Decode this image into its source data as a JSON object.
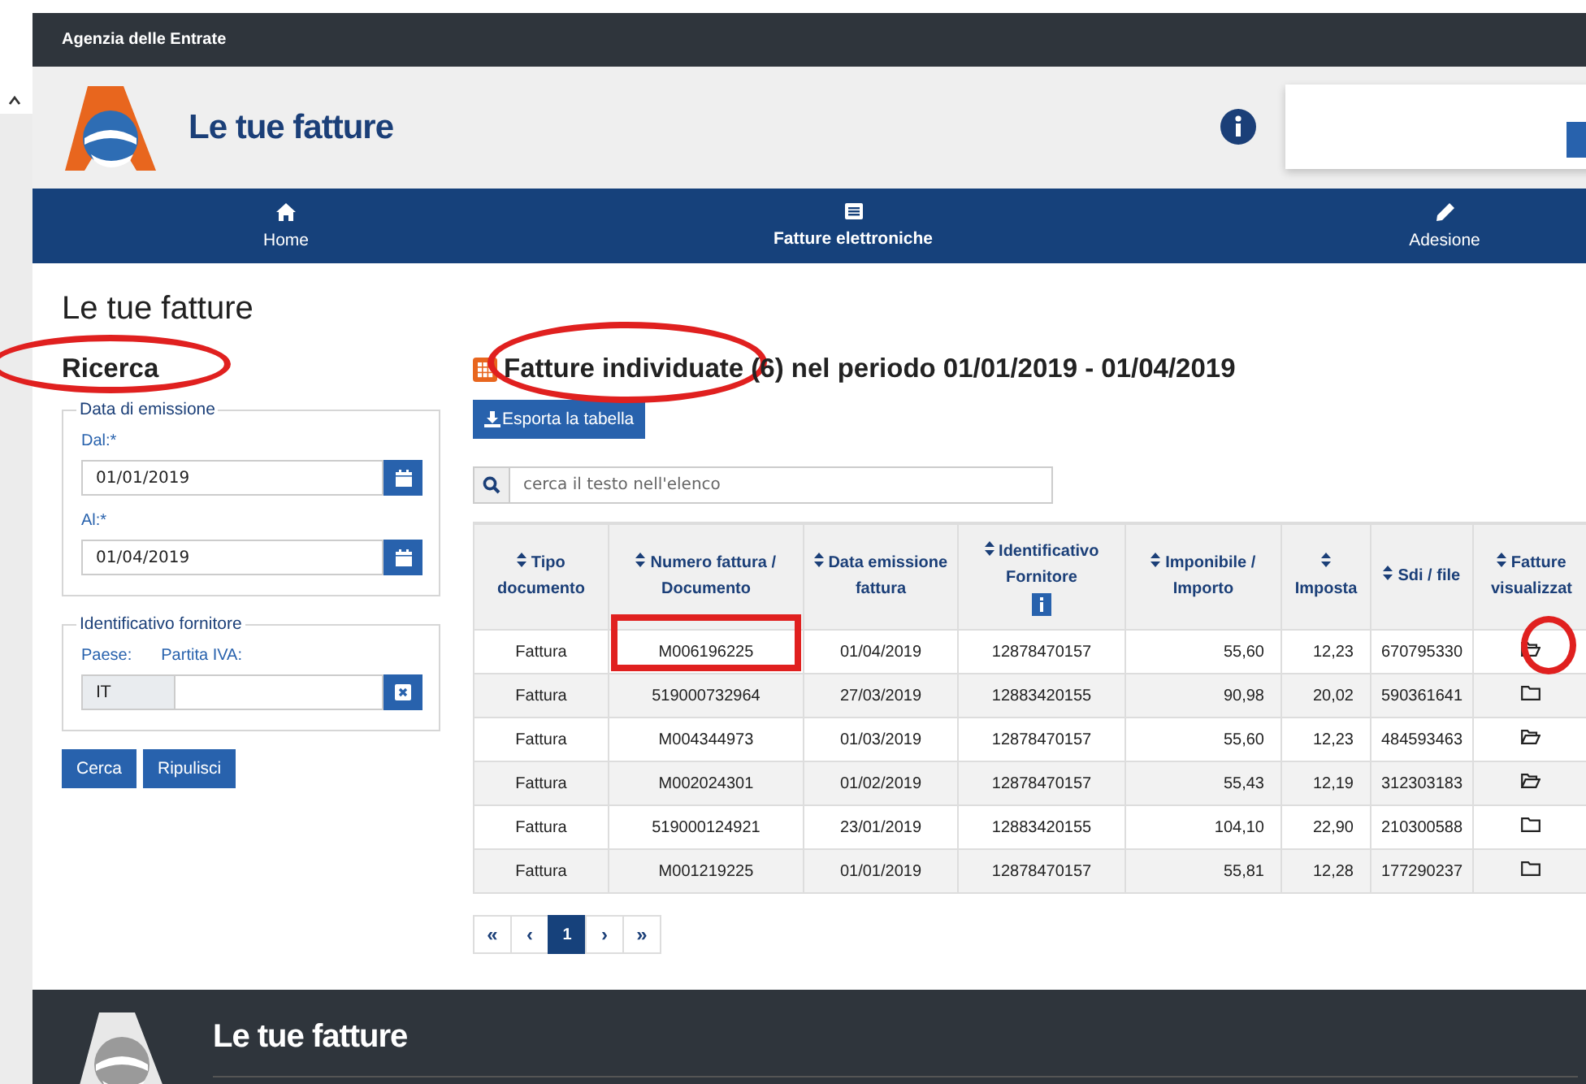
{
  "agency": "Agenzia delle Entrate",
  "app_title": "Le tue fatture",
  "nav": [
    {
      "label": "Home",
      "selected": false
    },
    {
      "label": "Fatture elettroniche",
      "selected": true
    },
    {
      "label": "Adesione",
      "selected": false
    }
  ],
  "page_title": "Le tue fatture",
  "search": {
    "title": "Ricerca",
    "date_group": {
      "legend": "Data di emissione",
      "from_label": "Dal:*",
      "from_value": "01/01/2019",
      "to_label": "Al:*",
      "to_value": "01/04/2019"
    },
    "supplier_group": {
      "legend": "Identificativo fornitore",
      "country_label": "Paese:",
      "vat_label": "Partita IVA:",
      "country_value": "IT"
    },
    "buttons": [
      "Cerca",
      "Ripulisci"
    ]
  },
  "results": {
    "title": "Fatture individuate (6) nel periodo 01/01/2019 - 01/04/2019",
    "export_button": "Esporta la tabella",
    "filter": {
      "placeholder": "cerca il testo nell'elenco"
    },
    "columns": [
      {
        "label": "Tipo documento",
        "info": false
      },
      {
        "label": "Numero fattura / Documento",
        "info": false
      },
      {
        "label": "Data emissione fattura",
        "info": false
      },
      {
        "label": "Identificativo Fornitore",
        "info": true
      },
      {
        "label": "Imponibile / Importo",
        "info": false
      },
      {
        "label": "Imposta",
        "info": false
      },
      {
        "label": "Sdi / file",
        "info": false
      },
      {
        "label": "Fatture visualizzat",
        "info": false
      }
    ],
    "rows": [
      {
        "type": "Fattura",
        "number": "M006196225",
        "date": "01/04/2019",
        "supplier_id": "12878470157",
        "taxable": "55,60",
        "tax": "12,23",
        "sdi": "670795330",
        "viewed": true
      },
      {
        "type": "Fattura",
        "number": "519000732964",
        "date": "27/03/2019",
        "supplier_id": "12883420155",
        "taxable": "90,98",
        "tax": "20,02",
        "sdi": "590361641",
        "viewed": false
      },
      {
        "type": "Fattura",
        "number": "M004344973",
        "date": "01/03/2019",
        "supplier_id": "12878470157",
        "taxable": "55,60",
        "tax": "12,23",
        "sdi": "484593463",
        "viewed": true
      },
      {
        "type": "Fattura",
        "number": "M002024301",
        "date": "01/02/2019",
        "supplier_id": "12878470157",
        "taxable": "55,43",
        "tax": "12,19",
        "sdi": "312303183",
        "viewed": true
      },
      {
        "type": "Fattura",
        "number": "519000124921",
        "date": "23/01/2019",
        "supplier_id": "12883420155",
        "taxable": "104,10",
        "tax": "22,90",
        "sdi": "210300588",
        "viewed": false
      },
      {
        "type": "Fattura",
        "number": "M001219225",
        "date": "01/01/2019",
        "supplier_id": "12878470157",
        "taxable": "55,81",
        "tax": "12,28",
        "sdi": "177290237",
        "viewed": false
      }
    ],
    "pagination": [
      {
        "label": "«",
        "selected": false
      },
      {
        "label": "‹",
        "selected": false
      },
      {
        "label": "1",
        "selected": true
      },
      {
        "label": "›",
        "selected": false
      },
      {
        "label": "»",
        "selected": false
      }
    ]
  },
  "footer": {
    "title": "Le tue fatture"
  },
  "annotations": [
    {
      "kind": "ellipse"
    },
    {
      "kind": "ellipse"
    },
    {
      "kind": "rectangle"
    },
    {
      "kind": "circle"
    }
  ]
}
